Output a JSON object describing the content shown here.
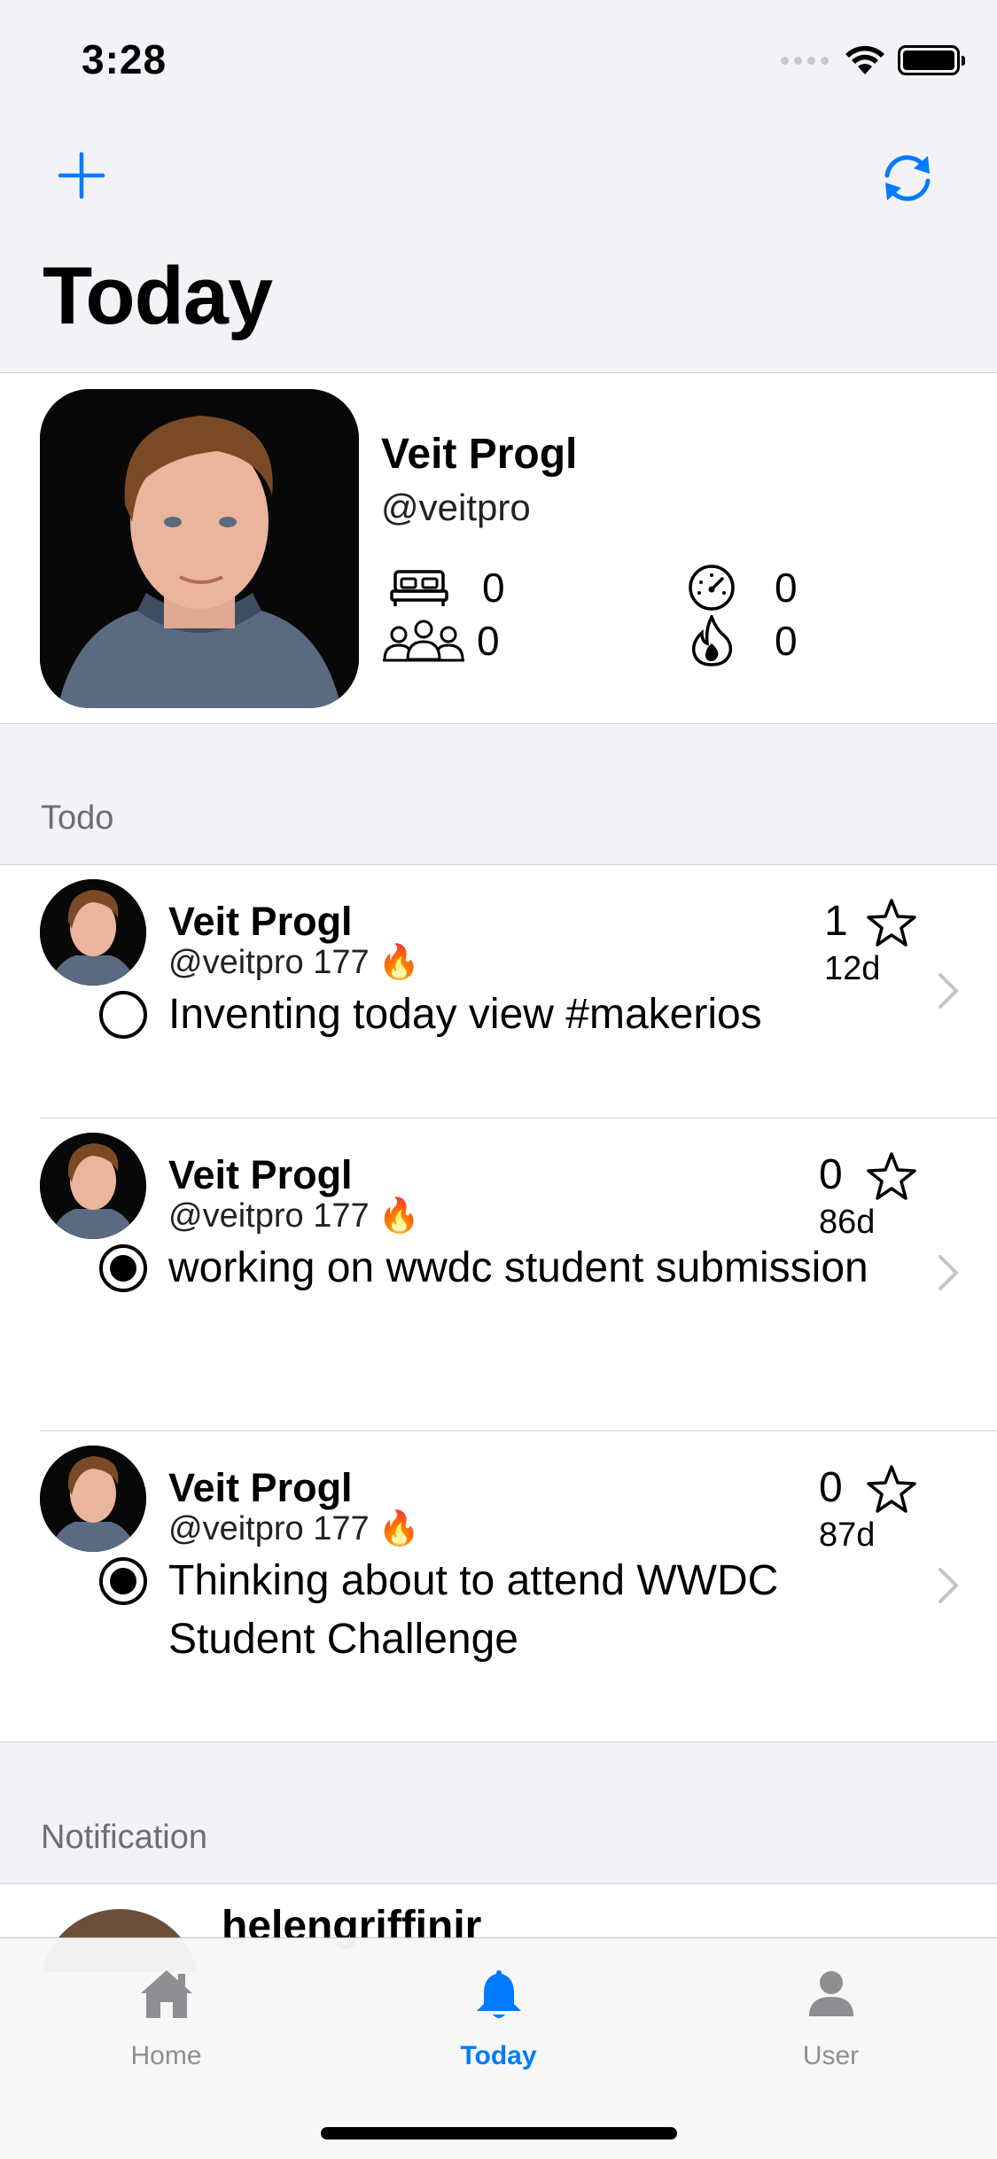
{
  "status_bar": {
    "time": "3:28"
  },
  "nav": {
    "title": "Today",
    "add_icon": "plus-icon",
    "refresh_icon": "refresh-icon"
  },
  "profile": {
    "name": "Veit Progl",
    "handle": "@veitpro",
    "stats": {
      "bed": "0",
      "speed": "0",
      "people": "0",
      "flame": "0"
    }
  },
  "sections": {
    "todo": "Todo",
    "notification": "Notification"
  },
  "todos": [
    {
      "name": "Veit Progl",
      "handle": "@veitpro 177",
      "count": "1",
      "age": "12d",
      "text": "Inventing today view #makerios",
      "done": false
    },
    {
      "name": "Veit Progl",
      "handle": "@veitpro 177",
      "count": "0",
      "age": "86d",
      "text": "working on wwdc student submission",
      "done": true
    },
    {
      "name": "Veit Progl",
      "handle": "@veitpro 177",
      "count": "0",
      "age": "87d",
      "text": "Thinking about to attend WWDC Student Challenge",
      "done": true
    }
  ],
  "notification": {
    "name": "helengriffinir"
  },
  "tabs": [
    {
      "label": "Home",
      "icon": "house-icon",
      "active": false
    },
    {
      "label": "Today",
      "icon": "bell-icon",
      "active": true
    },
    {
      "label": "User",
      "icon": "person-icon",
      "active": false
    }
  ],
  "colors": {
    "accent": "#007aff",
    "background": "#f2f2f7",
    "inactive": "#8e8e93"
  }
}
